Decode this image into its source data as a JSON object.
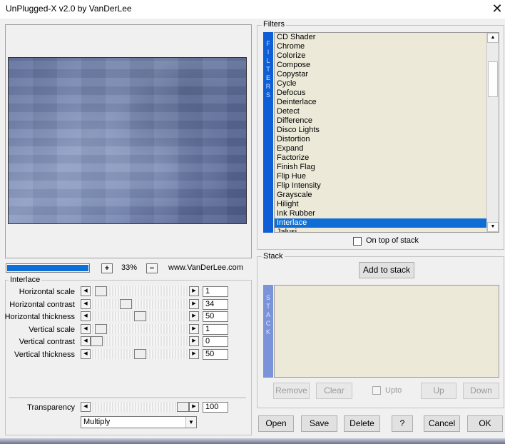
{
  "window": {
    "title": "UnPlugged-X v2.0 by VanDerLee",
    "close_glyph": "✕"
  },
  "preview": {
    "progress_fraction": 1.0,
    "zoom_plus": "+",
    "zoom_level": "33%",
    "zoom_minus": "−",
    "website": "www.VanDerLee.com"
  },
  "interlace": {
    "group_label": "Interlace",
    "params": [
      {
        "label": "Horizontal scale",
        "value": "1",
        "fraction": 0.05
      },
      {
        "label": "Horizontal contrast",
        "value": "34",
        "fraction": 0.34
      },
      {
        "label": "Horizontal thickness",
        "value": "50",
        "fraction": 0.5
      },
      {
        "label": "Vertical scale",
        "value": "1",
        "fraction": 0.05
      },
      {
        "label": "Vertical contrast",
        "value": "0",
        "fraction": 0.0
      },
      {
        "label": "Vertical thickness",
        "value": "50",
        "fraction": 0.5
      }
    ],
    "transparency": {
      "label": "Transparency",
      "value": "100",
      "fraction": 1.0
    },
    "blend_mode": "Multiply"
  },
  "filters": {
    "group_label": "Filters",
    "side_letters": [
      "F",
      "I",
      "L",
      "T",
      "E",
      "R",
      "S"
    ],
    "items": [
      "CD Shader",
      "Chrome",
      "Colorize",
      "Compose",
      "Copystar",
      "Cycle",
      "Defocus",
      "Deinterlace",
      "Detect",
      "Difference",
      "Disco Lights",
      "Distortion",
      "Expand",
      "Factorize",
      "Finish Flag",
      "Flip Hue",
      "Flip Intensity",
      "Grayscale",
      "Hilight",
      "Ink Rubber",
      "Interlace",
      "Jalusi"
    ],
    "selected": "Interlace",
    "on_top_label": "On top of stack"
  },
  "stack": {
    "group_label": "Stack",
    "add_label": "Add to stack",
    "side_letters": [
      "S",
      "T",
      "A",
      "C",
      "K"
    ],
    "remove_label": "Remove",
    "clear_label": "Clear",
    "upto_label": "Upto",
    "up_label": "Up",
    "down_label": "Down"
  },
  "footer": {
    "open": "Open",
    "save": "Save",
    "delete": "Delete",
    "help": "?",
    "cancel": "Cancel",
    "ok": "OK"
  }
}
